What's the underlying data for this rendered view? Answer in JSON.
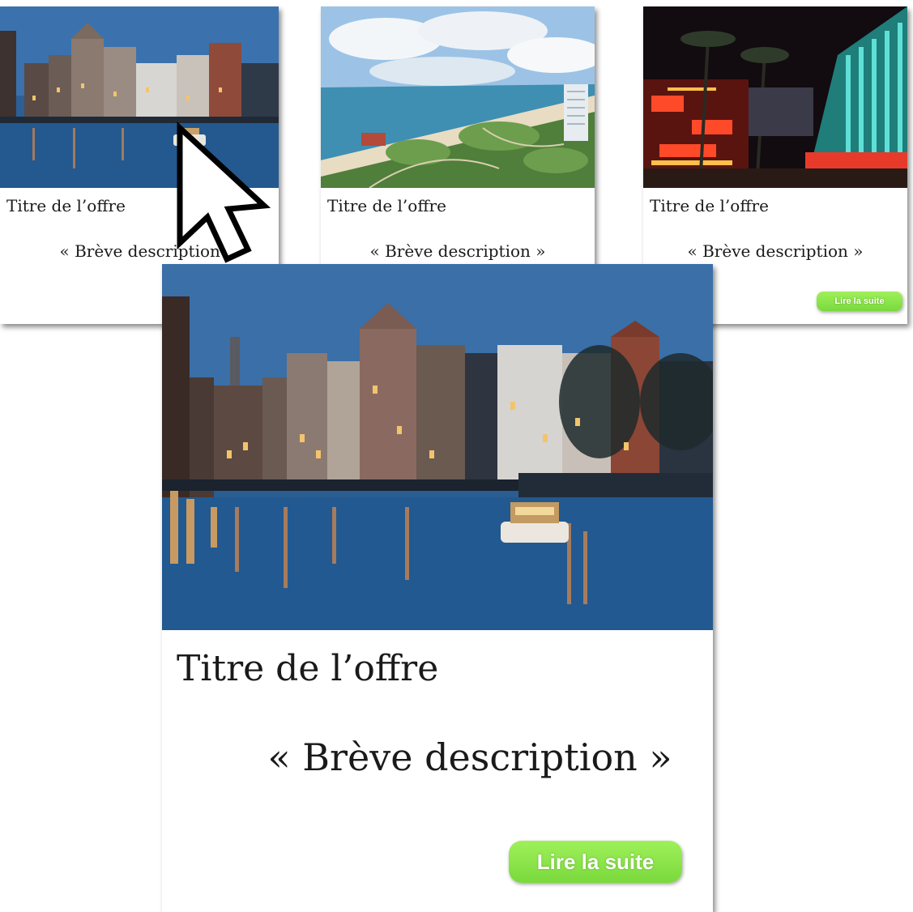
{
  "cards": [
    {
      "image": "amsterdam-canal-night",
      "title": "Titre de l’offre",
      "description": "« Brève description »"
    },
    {
      "image": "coastal-aerial-view",
      "title": "Titre de l’offre",
      "description": "« Brève description »"
    },
    {
      "image": "las-vegas-neon-street",
      "title": "Titre de l’offre",
      "description": "« Brève description »",
      "button": "Lire la suite"
    }
  ],
  "large_card": {
    "image": "amsterdam-canal-night",
    "title": "Titre de l’offre",
    "description": "« Brève description »",
    "button": "Lire la suite"
  },
  "colors": {
    "button": "#8fe64a",
    "button_text": "#ffffff"
  },
  "icons": {
    "cursor": "mouse-pointer-icon"
  }
}
